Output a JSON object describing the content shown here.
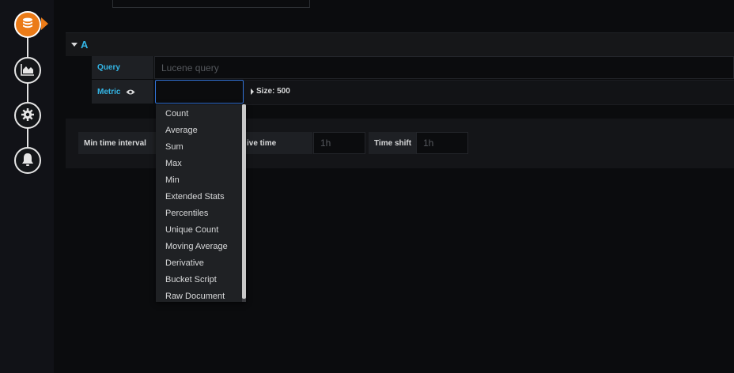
{
  "query": {
    "letter": "A",
    "query_label": "Query",
    "query_placeholder": "Lucene query",
    "metric_label": "Metric",
    "size_label": "Size: 500"
  },
  "metric_dropdown": {
    "options": [
      "Count",
      "Average",
      "Sum",
      "Max",
      "Min",
      "Extended Stats",
      "Percentiles",
      "Unique Count",
      "Moving Average",
      "Derivative",
      "Bucket Script",
      "Raw Document"
    ]
  },
  "options": {
    "min_interval_label": "Min time interval",
    "relative_time_label": "ive time",
    "relative_time_placeholder": "1h",
    "time_shift_label": "Time shift",
    "time_shift_placeholder": "1h"
  },
  "sidebar": {
    "steps": [
      "database-icon",
      "chart-icon",
      "settings-icon",
      "bell-icon"
    ],
    "active_color": "#eb7b18"
  },
  "colors": {
    "accent_blue": "#33b5e5",
    "focus_border": "#3274d9"
  }
}
